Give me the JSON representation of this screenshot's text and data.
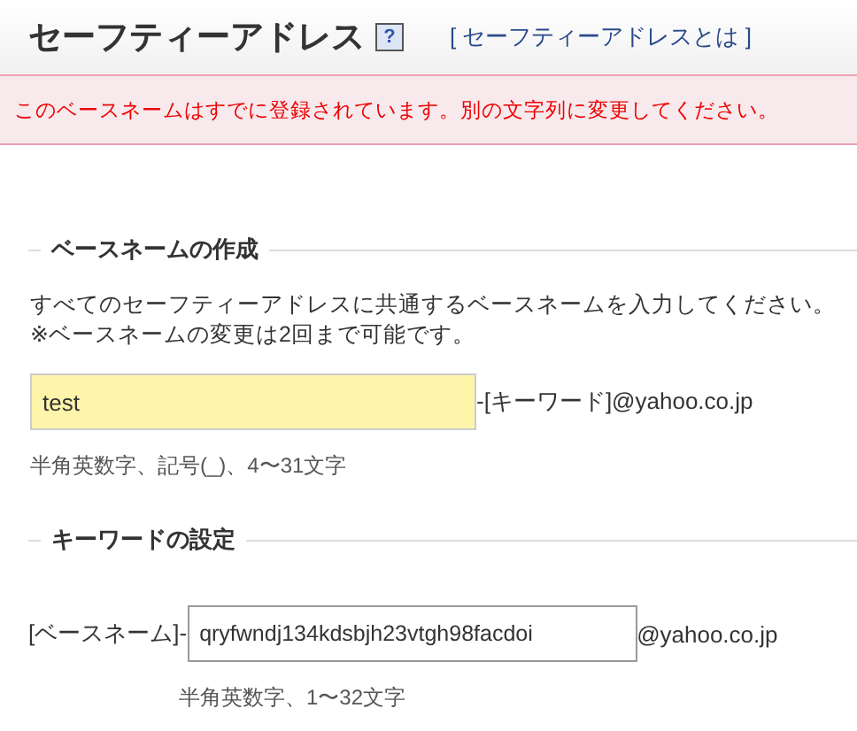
{
  "header": {
    "title": "セーフティーアドレス",
    "help_icon": "?",
    "link": "[ セーフティーアドレスとは ]"
  },
  "error": "このベースネームはすでに登録されています。別の文字列に変更してください。",
  "sections": [
    {
      "heading": "ベースネームの作成",
      "description": [
        "すべてのセーフティーアドレスに共通するベースネームを入力してください。",
        "※ベースネームの変更は2回まで可能です。"
      ],
      "value": "test",
      "highlighted": true,
      "suffix": "-[キーワード]@yahoo.co.jp",
      "hint": "半角英数字、記号(_)、4〜31文字"
    },
    {
      "heading": "キーワードの設定",
      "prefix": "[ベースネーム]-",
      "value": "qryfwndj134kdsbjh23vtgh98facdoi",
      "highlighted": false,
      "suffix": "@yahoo.co.jp",
      "hint": "半角英数字、1〜32文字"
    }
  ]
}
